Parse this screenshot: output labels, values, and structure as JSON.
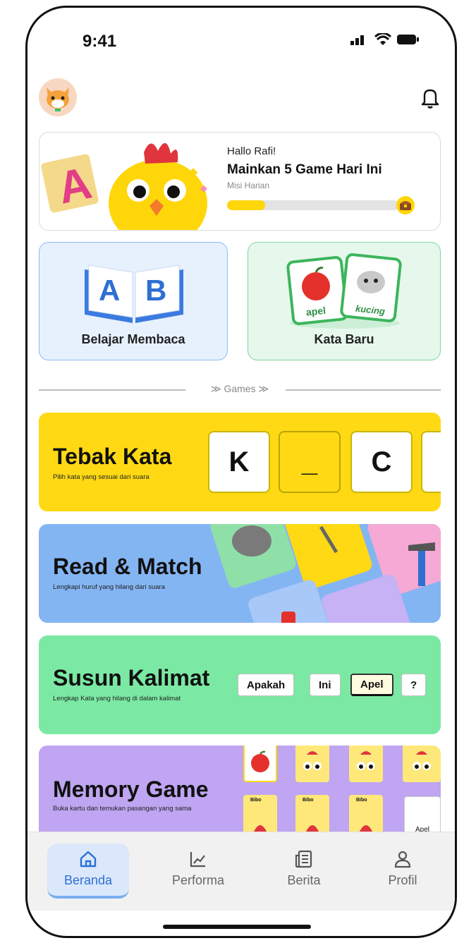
{
  "status": {
    "time": "9:41"
  },
  "mission": {
    "greeting": "Hallo Rafi!",
    "title": "Mainkan 5 Game Hari Ini",
    "subtitle": "Misi Harian",
    "progress": 0.22
  },
  "cards": {
    "reading": {
      "label": "Belajar Membaca",
      "book_letters": [
        "A",
        "B"
      ]
    },
    "words": {
      "label": "Kata Baru",
      "card1": "apel",
      "card2": "kucing"
    }
  },
  "divider": {
    "label": "Games"
  },
  "games": [
    {
      "title": "Tebak Kata",
      "desc": "Pilih kata yang sesuai dari suara",
      "tiles": [
        "K",
        "_",
        "C"
      ]
    },
    {
      "title": "Read & Match",
      "desc": "Lengkapi huruf yang hilang dari suara"
    },
    {
      "title": "Susun Kalimat",
      "desc": "Lengkap Kata yang hilang di dalam kalimat",
      "chips": [
        "Apakah",
        "Ini",
        "Apel",
        "?"
      ]
    },
    {
      "title": "Memory Game",
      "desc": "Buka kartu dan temukan pasangan yang sama",
      "card_labels": [
        "Bibo",
        "Bibo",
        "Bibo"
      ],
      "word_card": "Apel"
    }
  ],
  "tabs": [
    {
      "label": "Beranda",
      "icon": "home-icon",
      "active": true
    },
    {
      "label": "Performa",
      "icon": "chart-icon",
      "active": false
    },
    {
      "label": "Berita",
      "icon": "news-icon",
      "active": false
    },
    {
      "label": "Profil",
      "icon": "profile-icon",
      "active": false
    }
  ],
  "colors": {
    "accent": "#2c6fd6",
    "yellow": "#ffd914",
    "blue": "#84b5f3",
    "green": "#7be9a3",
    "purple": "#bfa5f2"
  }
}
